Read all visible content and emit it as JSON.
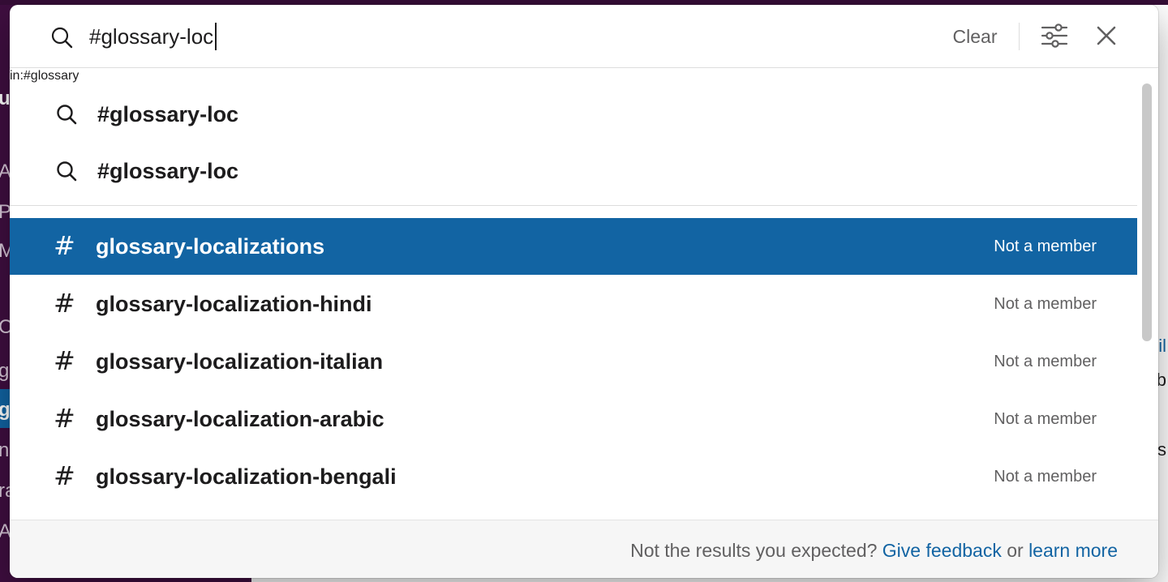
{
  "search": {
    "query": "#glossary-loc",
    "clear_label": "Clear"
  },
  "icons": {
    "search": "search-icon",
    "filter": "sliders-icon",
    "close": "close-icon",
    "channel": "hash-icon"
  },
  "suggestions": [
    {
      "text": "#glossary-loc",
      "modifier": ""
    },
    {
      "text": "#glossary-loc",
      "modifier": "in:#glossary"
    }
  ],
  "channels": [
    {
      "symbol": "#",
      "name": "glossary-localizations",
      "status": "Not a member",
      "selected": true
    },
    {
      "symbol": "#",
      "name": "glossary-localization-hindi",
      "status": "Not a member",
      "selected": false
    },
    {
      "symbol": "#",
      "name": "glossary-localization-italian",
      "status": "Not a member",
      "selected": false
    },
    {
      "symbol": "#",
      "name": "glossary-localization-arabic",
      "status": "Not a member",
      "selected": false
    },
    {
      "symbol": "#",
      "name": "glossary-localization-bengali",
      "status": "Not a member",
      "selected": false
    }
  ],
  "footer": {
    "prompt": "Not the results you expected?",
    "feedback_link": "Give feedback",
    "connector": "or",
    "learn_link": "learn more"
  },
  "background": {
    "sidebar_fragments": [
      "u",
      "A",
      "Pe",
      "M",
      "C",
      "ge",
      "gl",
      "na",
      "ra",
      "A"
    ],
    "main_fragments": [
      "il",
      "b",
      "es"
    ]
  },
  "colors": {
    "selected_row": "#1264a3",
    "link": "#1264a3",
    "sidebar": "#3f0e40"
  }
}
